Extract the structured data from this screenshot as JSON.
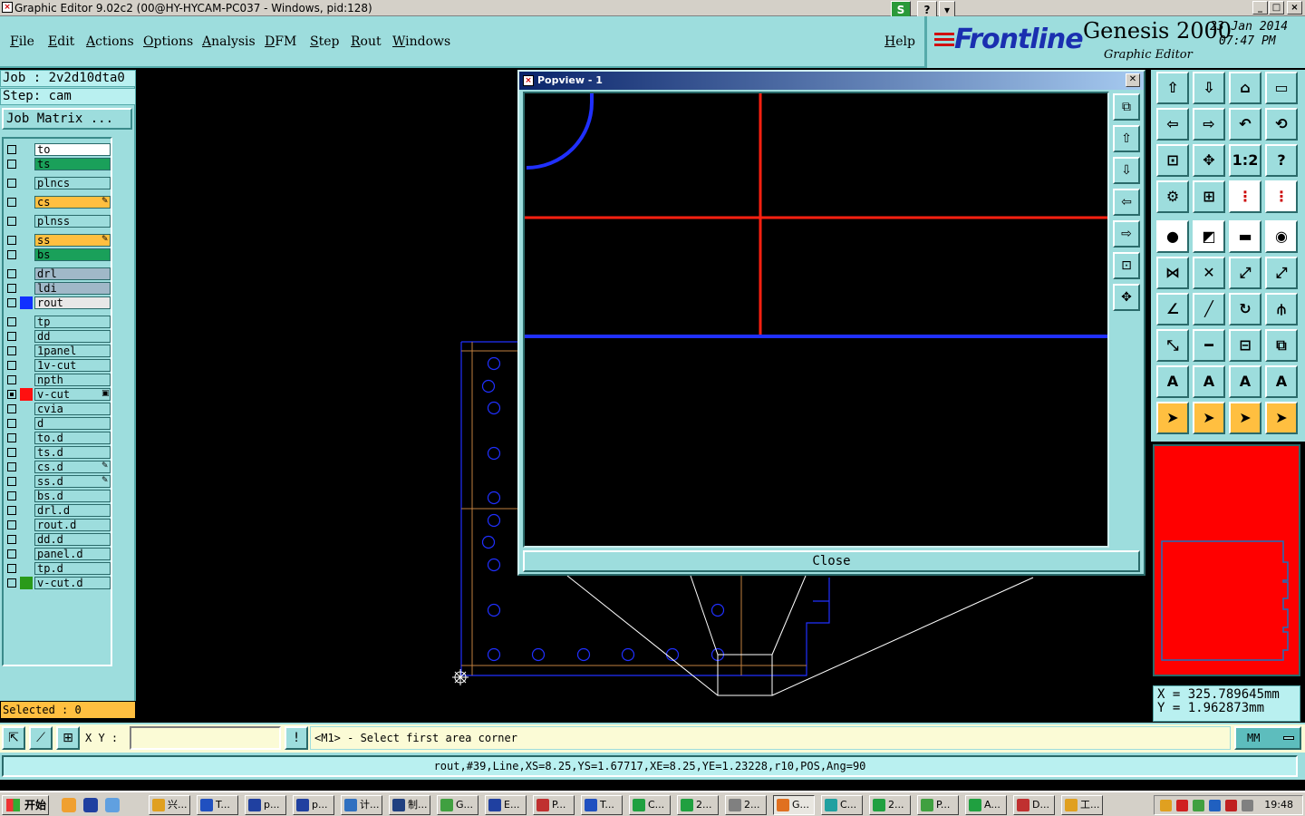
{
  "window": {
    "title": "Graphic Editor 9.02c2 (00@HY-HYCAM-PC037 - Windows, pid:128)",
    "extra_buttons": [
      "S",
      "?",
      "▾"
    ],
    "controls": [
      "_",
      "□",
      "×"
    ]
  },
  "menu": {
    "items": [
      "File",
      "Edit",
      "Actions",
      "Options",
      "Analysis",
      "DFM",
      "Step",
      "Rout",
      "Windows"
    ],
    "help": "Help"
  },
  "brand": {
    "logo": "Frontline",
    "product": "Genesis 2000",
    "subtitle": "Graphic Editor",
    "date": "23 Jan 2014",
    "time": "07:47 PM"
  },
  "job": {
    "job_line": "Job : 2v2d10dta0",
    "step_line": "Step: cam",
    "job_matrix": "Job Matrix ..."
  },
  "layers": [
    {
      "name": "to",
      "color": "#ffffff",
      "swatch": "",
      "checked": false,
      "mark": ""
    },
    {
      "name": "ts",
      "color": "#1aa05a",
      "swatch": "",
      "checked": false,
      "mark": ""
    },
    {
      "name": "plncs",
      "color": "#9ddddd",
      "swatch": "",
      "checked": false,
      "mark": ""
    },
    {
      "name": "cs",
      "color": "#ffbf40",
      "swatch": "",
      "checked": false,
      "mark": "✎"
    },
    {
      "name": "plnss",
      "color": "#9ddddd",
      "swatch": "",
      "checked": false,
      "mark": ""
    },
    {
      "name": "ss",
      "color": "#ffbf40",
      "swatch": "",
      "checked": false,
      "mark": "✎"
    },
    {
      "name": "bs",
      "color": "#1aa05a",
      "swatch": "",
      "checked": false,
      "mark": ""
    },
    {
      "name": "drl",
      "color": "#a0b8c8",
      "swatch": "",
      "checked": false,
      "mark": ""
    },
    {
      "name": "ldi",
      "color": "#a0b8c8",
      "swatch": "",
      "checked": false,
      "mark": ""
    },
    {
      "name": "rout",
      "color": "#e8e8e8",
      "swatch": "#1030ff",
      "checked": false,
      "mark": ""
    },
    {
      "name": "tp",
      "color": "#9ddddd",
      "swatch": "",
      "checked": false,
      "mark": ""
    },
    {
      "name": "dd",
      "color": "#9ddddd",
      "swatch": "",
      "checked": false,
      "mark": ""
    },
    {
      "name": "1panel",
      "color": "#9ddddd",
      "swatch": "",
      "checked": false,
      "mark": ""
    },
    {
      "name": "1v-cut",
      "color": "#9ddddd",
      "swatch": "",
      "checked": false,
      "mark": ""
    },
    {
      "name": "npth",
      "color": "#9ddddd",
      "swatch": "",
      "checked": false,
      "mark": ""
    },
    {
      "name": "v-cut",
      "color": "#9ddddd",
      "swatch": "#ff1010",
      "checked": true,
      "mark": "▣"
    },
    {
      "name": "cvia",
      "color": "#9ddddd",
      "swatch": "",
      "checked": false,
      "mark": ""
    },
    {
      "name": "d",
      "color": "#9ddddd",
      "swatch": "",
      "checked": false,
      "mark": ""
    },
    {
      "name": "to.d",
      "color": "#9ddddd",
      "swatch": "",
      "checked": false,
      "mark": ""
    },
    {
      "name": "ts.d",
      "color": "#9ddddd",
      "swatch": "",
      "checked": false,
      "mark": ""
    },
    {
      "name": "cs.d",
      "color": "#9ddddd",
      "swatch": "",
      "checked": false,
      "mark": "✎"
    },
    {
      "name": "ss.d",
      "color": "#9ddddd",
      "swatch": "",
      "checked": false,
      "mark": "✎"
    },
    {
      "name": "bs.d",
      "color": "#9ddddd",
      "swatch": "",
      "checked": false,
      "mark": ""
    },
    {
      "name": "drl.d",
      "color": "#9ddddd",
      "swatch": "",
      "checked": false,
      "mark": ""
    },
    {
      "name": "rout.d",
      "color": "#9ddddd",
      "swatch": "",
      "checked": false,
      "mark": ""
    },
    {
      "name": "dd.d",
      "color": "#9ddddd",
      "swatch": "",
      "checked": false,
      "mark": ""
    },
    {
      "name": "panel.d",
      "color": "#9ddddd",
      "swatch": "",
      "checked": false,
      "mark": ""
    },
    {
      "name": "tp.d",
      "color": "#9ddddd",
      "swatch": "",
      "checked": false,
      "mark": ""
    },
    {
      "name": "v-cut.d",
      "color": "#9ddddd",
      "swatch": "#2a9a1a",
      "checked": false,
      "mark": ""
    }
  ],
  "selected": "Selected : 0",
  "popview": {
    "title": "Popview - 1",
    "close_label": "Close"
  },
  "coords": {
    "x": "X = 325.789645mm",
    "y": "Y = 1.962873mm"
  },
  "command": {
    "xy_label": "X Y :",
    "xy_value": "",
    "prompt": "<M1> - Select first area corner",
    "units": "MM"
  },
  "status": "rout,#39,Line,XS=8.25,YS=1.67717,XE=8.25,YE=1.23228,r10,POS,Ang=90",
  "taskbar": {
    "start": "开始",
    "tasks": [
      "兴...",
      "T...",
      "p...",
      "p...",
      "计...",
      "制...",
      "G...",
      "E...",
      "P...",
      "T...",
      "C...",
      "2...",
      "2...",
      "G...",
      "C...",
      "2...",
      "P...",
      "A...",
      "D...",
      "工..."
    ],
    "clock": "19:48"
  }
}
